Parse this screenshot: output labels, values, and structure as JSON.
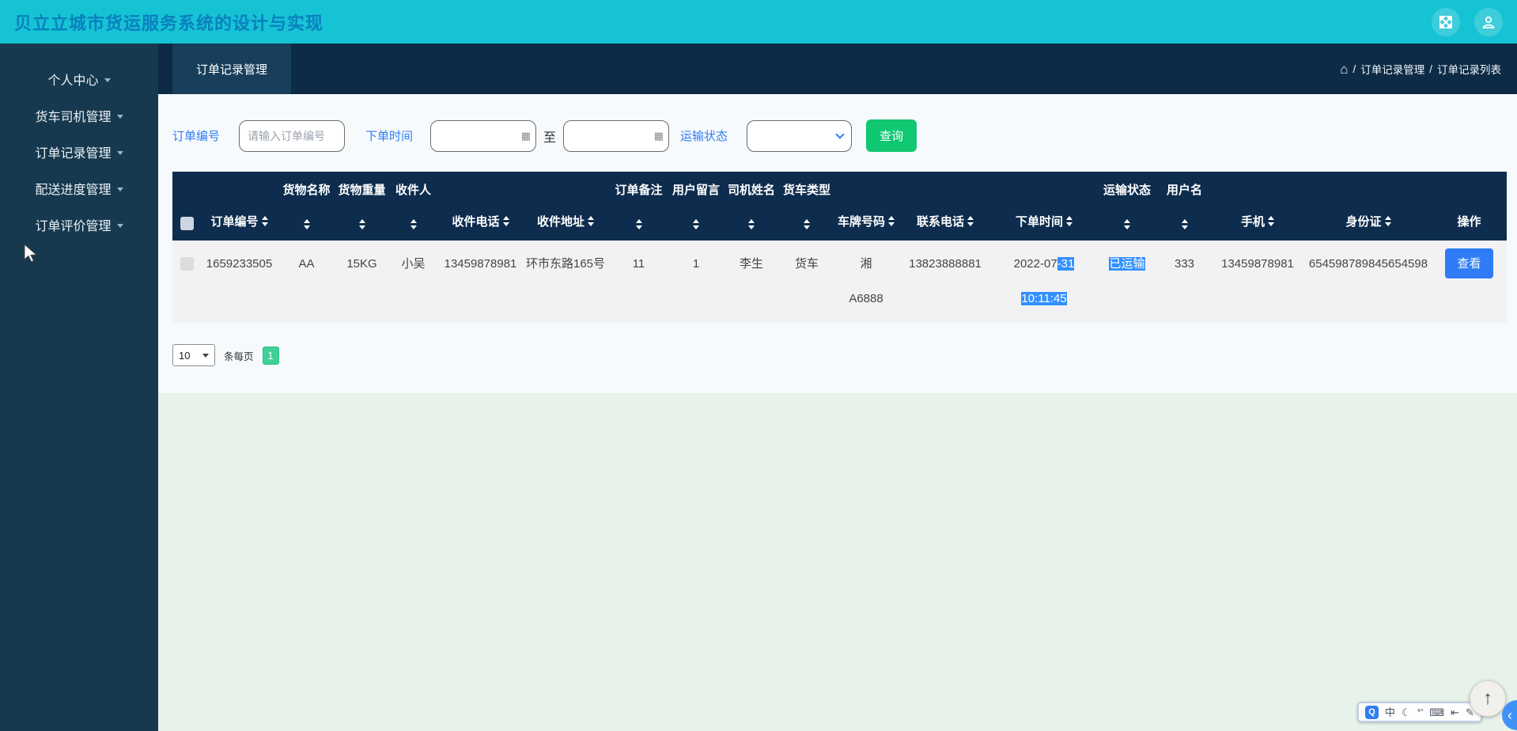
{
  "topbar": {
    "title": "贝立立城市货运服务系统的设计与实现"
  },
  "sidebar": {
    "items": [
      {
        "label": "个人中心"
      },
      {
        "label": "货车司机管理"
      },
      {
        "label": "订单记录管理"
      },
      {
        "label": "配送进度管理"
      },
      {
        "label": "订单评价管理"
      }
    ]
  },
  "tabbar": {
    "active_tab": "订单记录管理",
    "breadcrumb": {
      "separator": "/",
      "items": [
        "订单记录管理",
        "订单记录列表"
      ]
    }
  },
  "filters": {
    "order_no_label": "订单编号",
    "order_no_placeholder": "请输入订单编号",
    "order_time_label": "下单时间",
    "to_label": "至",
    "status_label": "运输状态",
    "status_value": "",
    "search_button": "查询"
  },
  "table": {
    "group_headers": {
      "cargo_name": "货物名称",
      "cargo_weight": "货物重量",
      "receiver": "收件人",
      "order_note": "订单备注",
      "user_message": "用户留言",
      "driver_name": "司机姓名",
      "truck_type": "货车类型",
      "transport_status": "运输状态",
      "username": "用户名"
    },
    "column_headers": {
      "order_no": "订单编号",
      "receiver_phone": "收件电话",
      "receiver_address": "收件地址",
      "plate_no": "车牌号码",
      "contact_phone": "联系电话",
      "order_time": "下单时间",
      "mobile": "手机",
      "id_card": "身份证",
      "action": "操作"
    },
    "row": {
      "order_no": "1659233505",
      "cargo_name": "AA",
      "cargo_weight": "15KG",
      "receiver": "小吴",
      "receiver_phone": "13459878981",
      "receiver_address": "环市东路165号",
      "order_note": "11",
      "user_message": "1",
      "driver_name": "李生",
      "truck_type": "货车",
      "plate_line1": "湘",
      "plate_line2": "A6888",
      "contact_phone": "13823888881",
      "order_date_plain": "2022-07",
      "order_date_selected": "-31",
      "order_time_selected": "10:11:45",
      "transport_status": "已运输",
      "username": "333",
      "mobile": "13459878981",
      "id_card": "654598789845654598",
      "action_label": "查看"
    }
  },
  "pagination": {
    "page_size": "10",
    "per_page_label": "条每页",
    "current_page": "1"
  },
  "widgets": {
    "ime_toolbar": {
      "icons": [
        {
          "name": "ime-logo-icon",
          "glyph": "Q"
        },
        {
          "name": "chinese-mode-icon",
          "glyph": "中"
        },
        {
          "name": "moon-icon",
          "glyph": "☾"
        },
        {
          "name": "punctuation-icon",
          "glyph": "°'"
        },
        {
          "name": "keyboard-icon",
          "glyph": "⌨"
        },
        {
          "name": "cursor-tool-icon",
          "glyph": "⇤"
        },
        {
          "name": "wrench-icon",
          "glyph": "✎"
        }
      ]
    },
    "back_to_top": "↑",
    "edge_chevron": "‹"
  },
  "colors": {
    "topbar_cyan": "#15C3D5",
    "navy_header": "#0D2B46",
    "table_header": "#0E2D4E",
    "accent_blue": "#2F7CF6",
    "search_green": "#11C872",
    "selection_blue": "#3390FF",
    "page_badge_green": "#40CF96"
  }
}
